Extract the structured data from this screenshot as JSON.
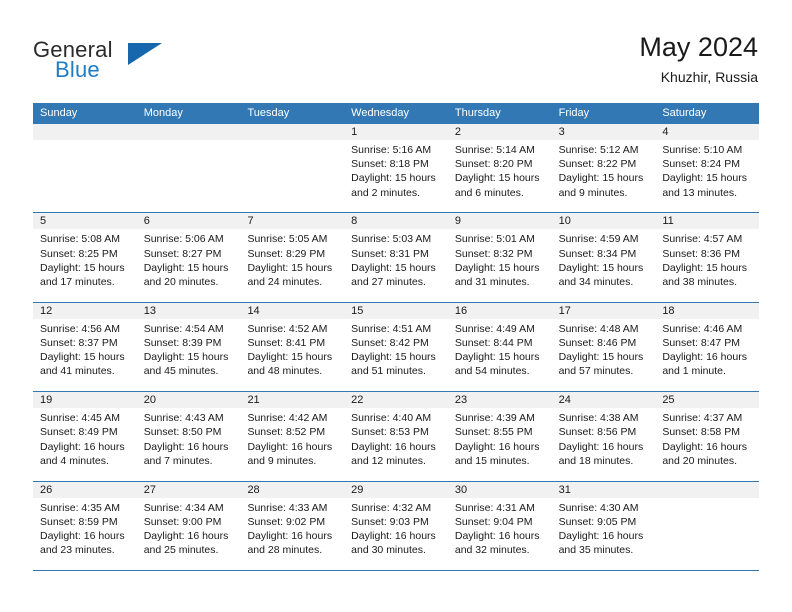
{
  "brand": {
    "line1": "General",
    "line2": "Blue",
    "mark": "triangle-logo"
  },
  "header": {
    "title": "May 2024",
    "subtitle": "Khuzhir, Russia"
  },
  "weekdays": [
    "Sunday",
    "Monday",
    "Tuesday",
    "Wednesday",
    "Thursday",
    "Friday",
    "Saturday"
  ],
  "colors": {
    "header_blue": "#3178b5",
    "brand_blue": "#1f7dc4",
    "daynum_bg": "#f1f1f1",
    "text": "#1a1a1a"
  },
  "weeks": [
    [
      {
        "empty": true
      },
      {
        "empty": true
      },
      {
        "empty": true
      },
      {
        "day": "1",
        "sunrise": "Sunrise: 5:16 AM",
        "sunset": "Sunset: 8:18 PM",
        "daylight1": "Daylight: 15 hours",
        "daylight2": "and 2 minutes."
      },
      {
        "day": "2",
        "sunrise": "Sunrise: 5:14 AM",
        "sunset": "Sunset: 8:20 PM",
        "daylight1": "Daylight: 15 hours",
        "daylight2": "and 6 minutes."
      },
      {
        "day": "3",
        "sunrise": "Sunrise: 5:12 AM",
        "sunset": "Sunset: 8:22 PM",
        "daylight1": "Daylight: 15 hours",
        "daylight2": "and 9 minutes."
      },
      {
        "day": "4",
        "sunrise": "Sunrise: 5:10 AM",
        "sunset": "Sunset: 8:24 PM",
        "daylight1": "Daylight: 15 hours",
        "daylight2": "and 13 minutes."
      }
    ],
    [
      {
        "day": "5",
        "sunrise": "Sunrise: 5:08 AM",
        "sunset": "Sunset: 8:25 PM",
        "daylight1": "Daylight: 15 hours",
        "daylight2": "and 17 minutes."
      },
      {
        "day": "6",
        "sunrise": "Sunrise: 5:06 AM",
        "sunset": "Sunset: 8:27 PM",
        "daylight1": "Daylight: 15 hours",
        "daylight2": "and 20 minutes."
      },
      {
        "day": "7",
        "sunrise": "Sunrise: 5:05 AM",
        "sunset": "Sunset: 8:29 PM",
        "daylight1": "Daylight: 15 hours",
        "daylight2": "and 24 minutes."
      },
      {
        "day": "8",
        "sunrise": "Sunrise: 5:03 AM",
        "sunset": "Sunset: 8:31 PM",
        "daylight1": "Daylight: 15 hours",
        "daylight2": "and 27 minutes."
      },
      {
        "day": "9",
        "sunrise": "Sunrise: 5:01 AM",
        "sunset": "Sunset: 8:32 PM",
        "daylight1": "Daylight: 15 hours",
        "daylight2": "and 31 minutes."
      },
      {
        "day": "10",
        "sunrise": "Sunrise: 4:59 AM",
        "sunset": "Sunset: 8:34 PM",
        "daylight1": "Daylight: 15 hours",
        "daylight2": "and 34 minutes."
      },
      {
        "day": "11",
        "sunrise": "Sunrise: 4:57 AM",
        "sunset": "Sunset: 8:36 PM",
        "daylight1": "Daylight: 15 hours",
        "daylight2": "and 38 minutes."
      }
    ],
    [
      {
        "day": "12",
        "sunrise": "Sunrise: 4:56 AM",
        "sunset": "Sunset: 8:37 PM",
        "daylight1": "Daylight: 15 hours",
        "daylight2": "and 41 minutes."
      },
      {
        "day": "13",
        "sunrise": "Sunrise: 4:54 AM",
        "sunset": "Sunset: 8:39 PM",
        "daylight1": "Daylight: 15 hours",
        "daylight2": "and 45 minutes."
      },
      {
        "day": "14",
        "sunrise": "Sunrise: 4:52 AM",
        "sunset": "Sunset: 8:41 PM",
        "daylight1": "Daylight: 15 hours",
        "daylight2": "and 48 minutes."
      },
      {
        "day": "15",
        "sunrise": "Sunrise: 4:51 AM",
        "sunset": "Sunset: 8:42 PM",
        "daylight1": "Daylight: 15 hours",
        "daylight2": "and 51 minutes."
      },
      {
        "day": "16",
        "sunrise": "Sunrise: 4:49 AM",
        "sunset": "Sunset: 8:44 PM",
        "daylight1": "Daylight: 15 hours",
        "daylight2": "and 54 minutes."
      },
      {
        "day": "17",
        "sunrise": "Sunrise: 4:48 AM",
        "sunset": "Sunset: 8:46 PM",
        "daylight1": "Daylight: 15 hours",
        "daylight2": "and 57 minutes."
      },
      {
        "day": "18",
        "sunrise": "Sunrise: 4:46 AM",
        "sunset": "Sunset: 8:47 PM",
        "daylight1": "Daylight: 16 hours",
        "daylight2": "and 1 minute."
      }
    ],
    [
      {
        "day": "19",
        "sunrise": "Sunrise: 4:45 AM",
        "sunset": "Sunset: 8:49 PM",
        "daylight1": "Daylight: 16 hours",
        "daylight2": "and 4 minutes."
      },
      {
        "day": "20",
        "sunrise": "Sunrise: 4:43 AM",
        "sunset": "Sunset: 8:50 PM",
        "daylight1": "Daylight: 16 hours",
        "daylight2": "and 7 minutes."
      },
      {
        "day": "21",
        "sunrise": "Sunrise: 4:42 AM",
        "sunset": "Sunset: 8:52 PM",
        "daylight1": "Daylight: 16 hours",
        "daylight2": "and 9 minutes."
      },
      {
        "day": "22",
        "sunrise": "Sunrise: 4:40 AM",
        "sunset": "Sunset: 8:53 PM",
        "daylight1": "Daylight: 16 hours",
        "daylight2": "and 12 minutes."
      },
      {
        "day": "23",
        "sunrise": "Sunrise: 4:39 AM",
        "sunset": "Sunset: 8:55 PM",
        "daylight1": "Daylight: 16 hours",
        "daylight2": "and 15 minutes."
      },
      {
        "day": "24",
        "sunrise": "Sunrise: 4:38 AM",
        "sunset": "Sunset: 8:56 PM",
        "daylight1": "Daylight: 16 hours",
        "daylight2": "and 18 minutes."
      },
      {
        "day": "25",
        "sunrise": "Sunrise: 4:37 AM",
        "sunset": "Sunset: 8:58 PM",
        "daylight1": "Daylight: 16 hours",
        "daylight2": "and 20 minutes."
      }
    ],
    [
      {
        "day": "26",
        "sunrise": "Sunrise: 4:35 AM",
        "sunset": "Sunset: 8:59 PM",
        "daylight1": "Daylight: 16 hours",
        "daylight2": "and 23 minutes."
      },
      {
        "day": "27",
        "sunrise": "Sunrise: 4:34 AM",
        "sunset": "Sunset: 9:00 PM",
        "daylight1": "Daylight: 16 hours",
        "daylight2": "and 25 minutes."
      },
      {
        "day": "28",
        "sunrise": "Sunrise: 4:33 AM",
        "sunset": "Sunset: 9:02 PM",
        "daylight1": "Daylight: 16 hours",
        "daylight2": "and 28 minutes."
      },
      {
        "day": "29",
        "sunrise": "Sunrise: 4:32 AM",
        "sunset": "Sunset: 9:03 PM",
        "daylight1": "Daylight: 16 hours",
        "daylight2": "and 30 minutes."
      },
      {
        "day": "30",
        "sunrise": "Sunrise: 4:31 AM",
        "sunset": "Sunset: 9:04 PM",
        "daylight1": "Daylight: 16 hours",
        "daylight2": "and 32 minutes."
      },
      {
        "day": "31",
        "sunrise": "Sunrise: 4:30 AM",
        "sunset": "Sunset: 9:05 PM",
        "daylight1": "Daylight: 16 hours",
        "daylight2": "and 35 minutes."
      },
      {
        "empty": true
      }
    ]
  ]
}
